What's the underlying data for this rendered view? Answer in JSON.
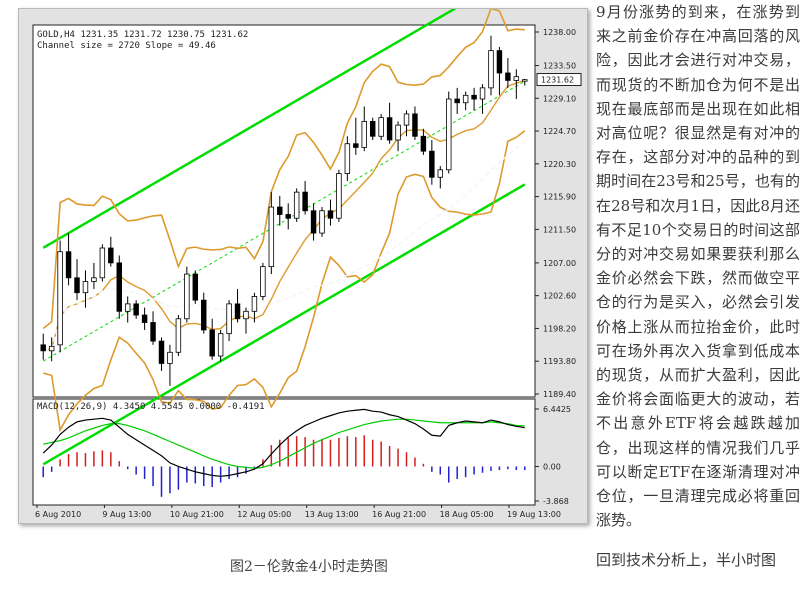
{
  "chart_data": [
    {
      "type": "candlestick",
      "instrument_header": "GOLD,H4  1231.35 1231.72 1230.75 1231.62",
      "channel_text": "Channel size = 2720 Slope = 49.46",
      "ylim": [
        1189.4,
        1238.0
      ],
      "y_ticks": [
        "1238.00",
        "1233.50",
        "1229.10",
        "1224.70",
        "1220.30",
        "1215.90",
        "1211.50",
        "1207.00",
        "1202.60",
        "1198.20",
        "1193.80",
        "1189.40"
      ],
      "current_price": "1231.62",
      "x_ticks": [
        "6 Aug 2010",
        "9 Aug 13:00",
        "10 Aug 21:00",
        "12 Aug 05:00",
        "13 Aug 13:00",
        "16 Aug 21:00",
        "18 Aug 05:00",
        "19 Aug 13:00"
      ],
      "candles": [
        [
          1196.0,
          1197.5,
          1194.0,
          1195.2
        ],
        [
          1195.2,
          1197.0,
          1193.8,
          1195.8
        ],
        [
          1196.0,
          1210.0,
          1195.0,
          1208.5
        ],
        [
          1208.5,
          1211.0,
          1204.0,
          1205.0
        ],
        [
          1205.0,
          1207.5,
          1202.0,
          1203.0
        ],
        [
          1203.0,
          1206.0,
          1201.0,
          1204.5
        ],
        [
          1204.5,
          1207.0,
          1203.5,
          1205.0
        ],
        [
          1205.0,
          1209.5,
          1204.5,
          1209.0
        ],
        [
          1209.0,
          1210.5,
          1206.5,
          1207.0
        ],
        [
          1207.0,
          1208.0,
          1199.5,
          1200.5
        ],
        [
          1200.5,
          1202.5,
          1199.0,
          1201.5
        ],
        [
          1201.5,
          1202.0,
          1199.5,
          1200.0
        ],
        [
          1200.0,
          1201.0,
          1198.0,
          1199.0
        ],
        [
          1199.0,
          1200.5,
          1196.0,
          1196.5
        ],
        [
          1196.5,
          1197.0,
          1192.5,
          1193.5
        ],
        [
          1193.5,
          1196.0,
          1190.5,
          1195.0
        ],
        [
          1195.0,
          1200.0,
          1194.5,
          1199.5
        ],
        [
          1199.5,
          1206.5,
          1199.0,
          1205.5
        ],
        [
          1205.5,
          1206.0,
          1201.5,
          1202.0
        ],
        [
          1202.0,
          1203.0,
          1197.5,
          1198.0
        ],
        [
          1198.0,
          1199.5,
          1194.0,
          1194.5
        ],
        [
          1194.5,
          1198.0,
          1193.8,
          1197.5
        ],
        [
          1197.5,
          1202.0,
          1196.5,
          1201.5
        ],
        [
          1201.5,
          1203.5,
          1199.0,
          1199.5
        ],
        [
          1199.5,
          1201.0,
          1197.5,
          1200.5
        ],
        [
          1200.5,
          1203.0,
          1199.0,
          1202.5
        ],
        [
          1202.5,
          1207.0,
          1202.0,
          1206.5
        ],
        [
          1206.5,
          1216.5,
          1205.5,
          1214.5
        ],
        [
          1214.5,
          1216.0,
          1212.0,
          1213.5
        ],
        [
          1213.5,
          1215.0,
          1211.5,
          1213.0
        ],
        [
          1213.0,
          1217.0,
          1212.5,
          1216.5
        ],
        [
          1216.5,
          1218.0,
          1213.5,
          1214.0
        ],
        [
          1214.0,
          1215.0,
          1210.0,
          1211.0
        ],
        [
          1211.0,
          1214.5,
          1210.5,
          1214.0
        ],
        [
          1214.0,
          1215.5,
          1212.0,
          1213.0
        ],
        [
          1213.0,
          1219.5,
          1212.5,
          1219.0
        ],
        [
          1219.0,
          1224.0,
          1218.0,
          1223.0
        ],
        [
          1223.0,
          1226.5,
          1221.5,
          1222.5
        ],
        [
          1222.5,
          1228.0,
          1222.0,
          1226.0
        ],
        [
          1226.0,
          1226.5,
          1223.5,
          1224.0
        ],
        [
          1224.0,
          1227.0,
          1223.5,
          1226.5
        ],
        [
          1226.5,
          1228.5,
          1223.0,
          1223.5
        ],
        [
          1223.5,
          1226.0,
          1222.0,
          1225.5
        ],
        [
          1225.5,
          1227.5,
          1224.0,
          1227.0
        ],
        [
          1227.0,
          1228.0,
          1223.5,
          1224.0
        ],
        [
          1224.0,
          1225.0,
          1221.5,
          1222.0
        ],
        [
          1222.0,
          1223.5,
          1217.5,
          1218.5
        ],
        [
          1218.5,
          1220.0,
          1217.0,
          1219.5
        ],
        [
          1219.5,
          1230.0,
          1219.0,
          1229.0
        ],
        [
          1229.0,
          1230.5,
          1227.0,
          1228.5
        ],
        [
          1228.5,
          1230.0,
          1227.5,
          1229.5
        ],
        [
          1229.5,
          1230.5,
          1227.5,
          1229.0
        ],
        [
          1229.0,
          1231.0,
          1227.0,
          1230.5
        ],
        [
          1230.5,
          1237.5,
          1229.5,
          1235.5
        ],
        [
          1235.5,
          1236.0,
          1229.5,
          1232.5
        ],
        [
          1232.5,
          1234.5,
          1230.5,
          1231.5
        ],
        [
          1231.5,
          1233.0,
          1229.0,
          1232.0
        ],
        [
          1231.4,
          1231.7,
          1230.8,
          1231.6
        ]
      ],
      "macd": {
        "label": "MACD(12,26,9) 4.3450 4.5545 0.0000 -0.4191",
        "y_ticks": [
          "6.4425",
          "0.00",
          "-3.868"
        ],
        "ylim": [
          -3.868,
          6.4425
        ],
        "histogram": [
          -1.2,
          -0.6,
          0.8,
          1.4,
          1.6,
          1.5,
          1.7,
          1.8,
          1.6,
          0.6,
          -0.3,
          -0.9,
          -1.4,
          -2.2,
          -3.4,
          -3.0,
          -2.6,
          -1.8,
          -1.9,
          -2.2,
          -2.3,
          -1.8,
          -1.4,
          -1.2,
          -0.8,
          -0.2,
          0.8,
          2.4,
          3.0,
          3.2,
          3.4,
          3.3,
          3.0,
          3.1,
          3.0,
          3.2,
          3.4,
          3.3,
          3.5,
          3.0,
          2.8,
          2.3,
          2.0,
          1.6,
          1.0,
          0.3,
          -0.6,
          -0.9,
          -1.8,
          -1.4,
          -1.2,
          -0.9,
          -0.7,
          -0.5,
          -0.4,
          -0.3,
          -0.4,
          -0.4
        ],
        "macd_line": [
          1.5,
          2.4,
          3.6,
          4.4,
          5.0,
          5.2,
          5.3,
          5.4,
          5.2,
          4.4,
          3.6,
          3.0,
          2.4,
          1.8,
          1.2,
          0.4,
          0.0,
          -0.3,
          -0.6,
          -0.8,
          -1.0,
          -1.1,
          -1.0,
          -0.8,
          -0.6,
          -0.3,
          0.3,
          1.4,
          2.4,
          3.3,
          4.0,
          4.6,
          5.0,
          5.4,
          5.7,
          6.0,
          6.2,
          6.3,
          6.4,
          6.2,
          6.1,
          5.8,
          5.6,
          5.2,
          4.8,
          4.2,
          3.5,
          3.4,
          4.6,
          4.9,
          5.1,
          5.0,
          4.9,
          5.2,
          5.0,
          4.7,
          4.5,
          4.35
        ],
        "signal_line": [
          2.5,
          2.7,
          2.9,
          3.2,
          3.6,
          4.0,
          4.3,
          4.6,
          4.8,
          4.8,
          4.6,
          4.3,
          4.0,
          3.6,
          3.2,
          2.8,
          2.4,
          2.0,
          1.6,
          1.2,
          0.8,
          0.5,
          0.2,
          0.0,
          -0.1,
          -0.2,
          -0.1,
          0.2,
          0.6,
          1.1,
          1.6,
          2.1,
          2.6,
          3.0,
          3.4,
          3.8,
          4.1,
          4.4,
          4.7,
          4.9,
          5.1,
          5.2,
          5.3,
          5.3,
          5.2,
          5.1,
          5.0,
          4.9,
          4.9,
          4.9,
          4.9,
          4.9,
          4.9,
          5.0,
          4.9,
          4.8,
          4.6,
          4.55
        ]
      }
    }
  ],
  "caption": "图2－伦敦金4小时走势图",
  "article": {
    "paragraph_1": "9月份涨势的到来，在涨势到来之前金价存在冲高回落的风险，因此才会进行对冲交易，而现货的不断加仓为何不是出现在最底部而是出现在如此相对高位呢？很显然是有对冲的存在，这部分对冲的品种的到期时间在23号和25号，也有的在28号和次月1日，因此8月还有不足10个交易日的时间这部分的对冲交易如果要获利那么金价必然会下跌，然而做空平仓的行为是买入，必然会引发价格上涨从而拉抬金价，此时可在场外再次入货拿到低成本的现货，从而扩大盈利，因此金价将会面临更大的波动，若不出意外ETF将会越跌越加仓，出现这样的情况我们几乎可以断定ETF在逐渐清理对冲仓位，一旦清理完成必将重回涨势。",
    "paragraph_2": "回到技术分析上，半小时图"
  },
  "colors": {
    "chart_bg": "#e2e2e2",
    "plot_bg": "#ffffff",
    "channel": "#00dd00",
    "bands": "#dd9a2b",
    "macd_up": "#d02020",
    "macd_down": "#2020d0",
    "macd_signal": "#00cc00",
    "text": "#3a3a3a"
  }
}
